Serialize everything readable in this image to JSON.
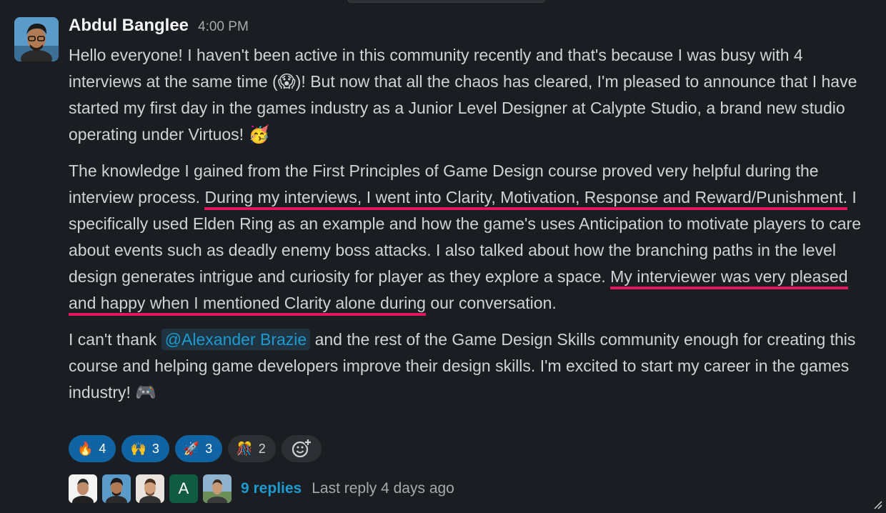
{
  "message": {
    "author": "Abdul Banglee",
    "time": "4:00 PM",
    "p1": {
      "text": "Hello everyone! I haven't been active in this community recently and that's because I was busy with 4 interviews at the same time (",
      "emoji1": "😱",
      "text2": ")! But now that all the chaos has cleared, I'm pleased to announce that I have started my first day in the games industry as a Junior Level Designer at Calypte Studio, a brand new studio operating under Virtuos! ",
      "emoji2": "🥳"
    },
    "p2": {
      "a": "The knowledge I gained from the First Principles of Game Design course proved very helpful during the interview process. ",
      "highlight1": "During my interviews, I went into Clarity, Motivation, Response and Reward/Punishment.",
      "b": " I specifically used Elden Ring as an example and how the game's uses Anticipation to motivate players to care about events such as deadly enemy boss attacks. I also talked about how the branching paths in the level design generates intrigue and curiosity for player as they explore a space. ",
      "highlight2": "My interviewer was very pleased and happy when I mentioned Clarity alone during",
      "c": " our conversation."
    },
    "p3": {
      "a": "I can't thank ",
      "mention": "@Alexander Brazie",
      "b": " and the rest of the Game Design Skills community enough for creating this course and helping game developers improve their design skills. I'm excited to start my career in the games industry! ",
      "emoji": "🎮"
    }
  },
  "reactions": [
    {
      "emoji": "🔥",
      "count": "4",
      "icon": "fire-icon"
    },
    {
      "emoji": "🙌",
      "count": "3",
      "icon": "raised-hands-icon"
    },
    {
      "emoji": "🚀",
      "count": "3",
      "icon": "rocket-icon"
    },
    {
      "emoji": "🎊",
      "count": "2",
      "icon": "confetti-icon"
    }
  ],
  "thread": {
    "avatar_letter": "A",
    "replies": "9 replies",
    "last_reply": "Last reply 4 days ago"
  },
  "colors": {
    "background": "#1a1d21",
    "text": "#d1d2d3",
    "link": "#1d9bd1",
    "underline": "#e2185e",
    "reaction_active": "#1164a3"
  }
}
